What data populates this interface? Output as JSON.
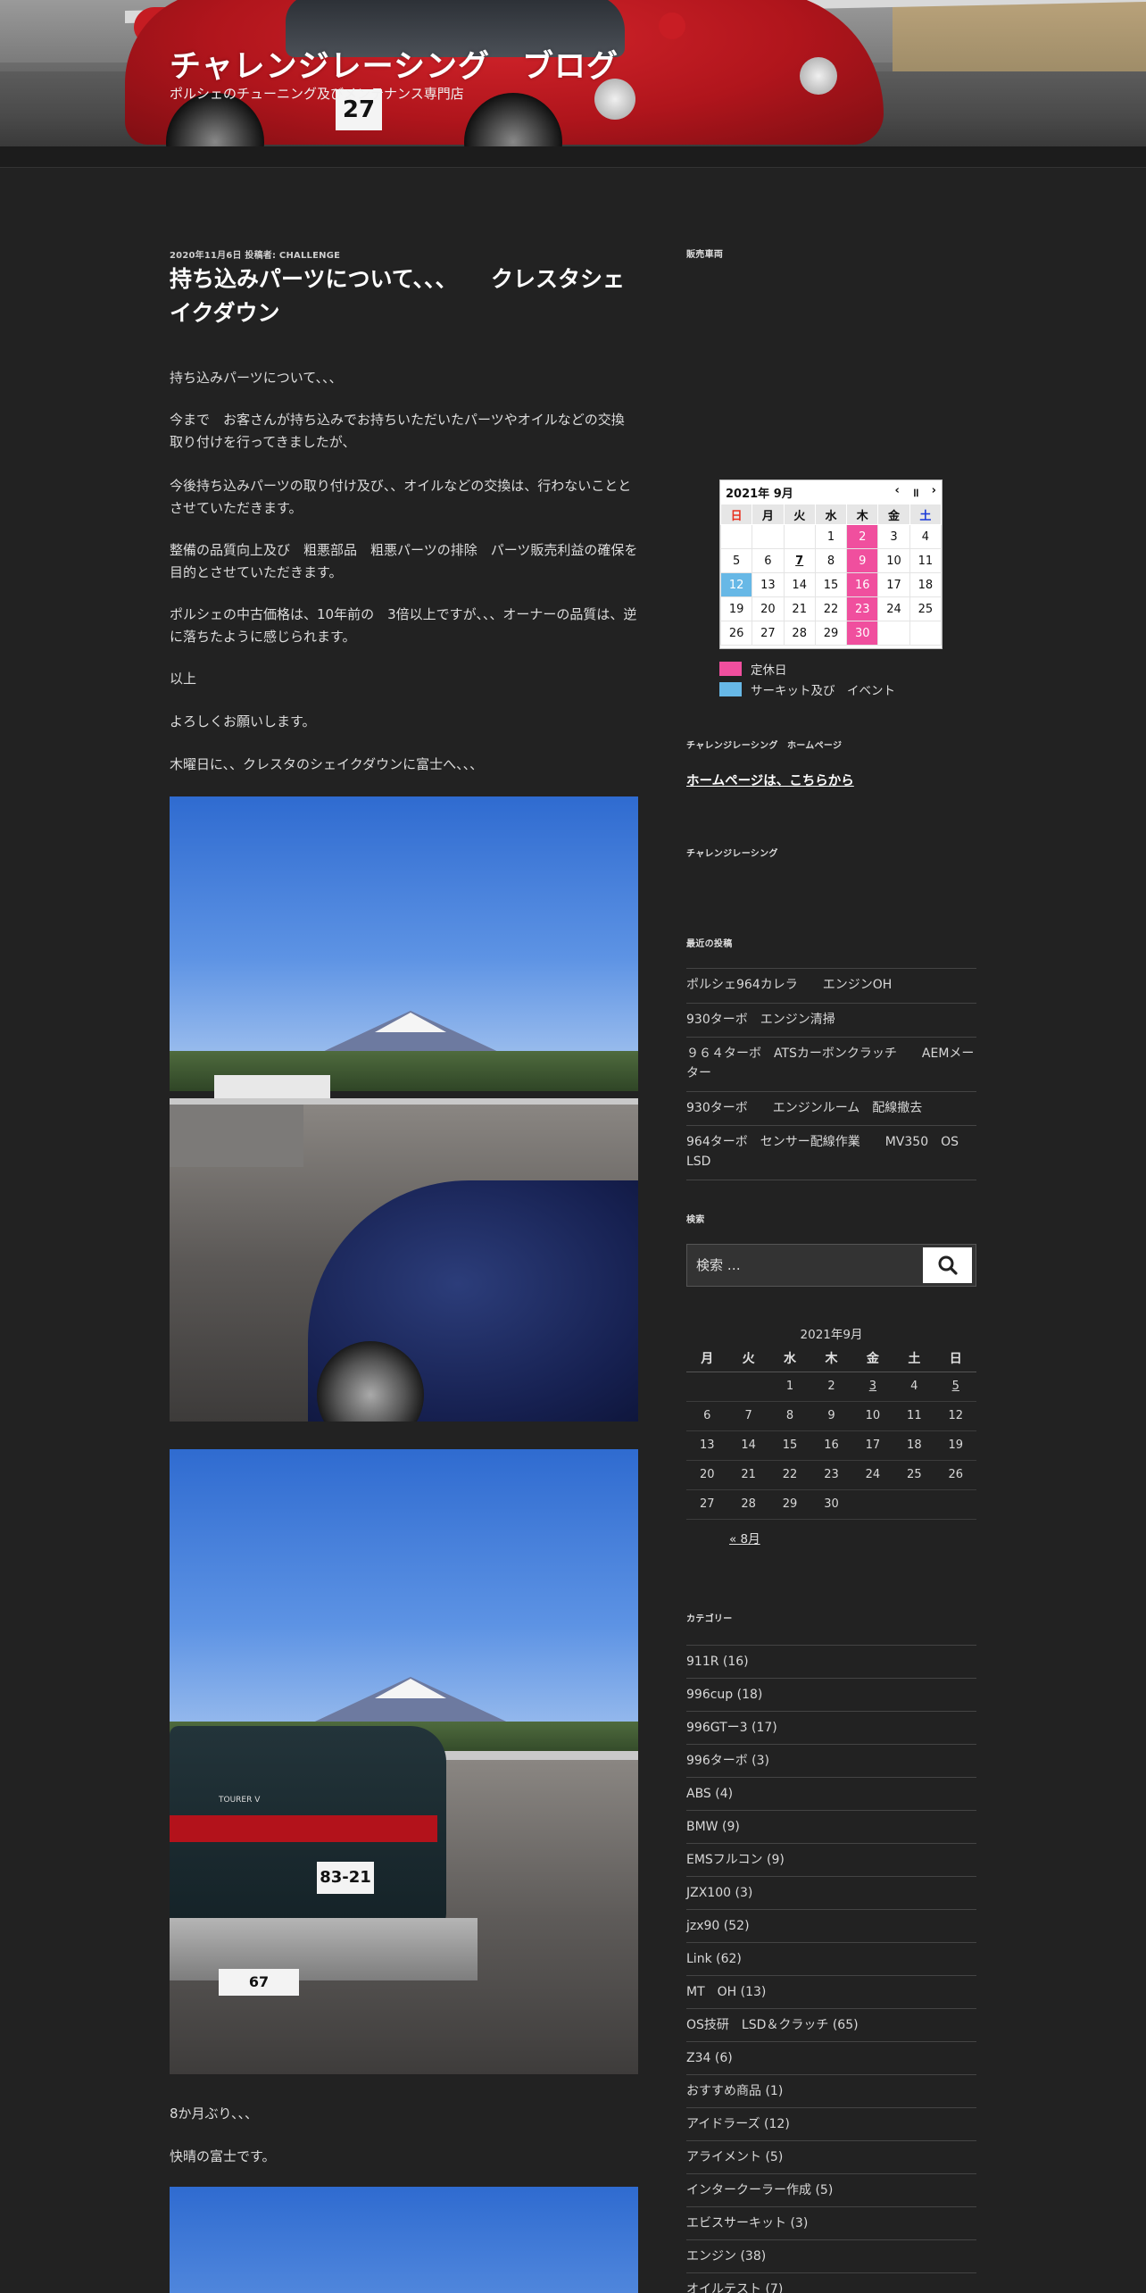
{
  "site": {
    "title": "チャレンジレーシング　ブログ",
    "description": "ポルシェのチューニング及びメンテナンス専門店"
  },
  "header_plate": "27",
  "post": {
    "date": "2020年11月6日",
    "author_prefix": "投稿者:",
    "author": "challenge",
    "title": "持ち込みパーツについて、、、　　クレスタシェイクダウン",
    "paragraphs": [
      "持ち込みパーツについて、、、",
      "今まで　お客さんが持ち込みでお持ちいただいたパーツやオイルなどの交換　取り付けを行ってきましたが、",
      "今後持ち込みパーツの取り付け及び、、オイルなどの交換は、行わないこととさせていただきます。",
      "整備の品質向上及び　粗悪部品　粗悪パーツの排除　パーツ販売利益の確保を目的とさせていただきます。",
      "ポルシェの中古価格は、10年前の　3倍以上ですが、、、オーナーの品質は、逆に落ちたように感じられます。",
      "以上",
      "よろしくお願いします。",
      "木曜日に、、クレスタのシェイクダウンに富士へ、、、"
    ],
    "after_photos": [
      "8か月ぶり、、、",
      "快晴の富士です。"
    ],
    "photo2_plate": "83-21",
    "photo2_plate2": "67",
    "photo2_badge": "TOURER V"
  },
  "sidebar": {
    "sale_title": "販売車両",
    "event_calendar": {
      "month_label": "2021年 9月",
      "nav_prev": "‹",
      "nav_pause": "॥",
      "nav_next": "›",
      "weekdays": [
        "日",
        "月",
        "火",
        "水",
        "木",
        "金",
        "土"
      ],
      "weeks": [
        [
          "",
          "",
          "",
          "1",
          "2",
          "3",
          "4"
        ],
        [
          "5",
          "6",
          "7",
          "8",
          "9",
          "10",
          "11"
        ],
        [
          "12",
          "13",
          "14",
          "15",
          "16",
          "17",
          "18"
        ],
        [
          "19",
          "20",
          "21",
          "22",
          "23",
          "24",
          "25"
        ],
        [
          "26",
          "27",
          "28",
          "29",
          "30",
          "",
          ""
        ]
      ],
      "holiday_days": [
        "2",
        "9",
        "16",
        "23",
        "30"
      ],
      "event_days": [
        "12"
      ],
      "today": "7",
      "legend": [
        {
          "label": "定休日",
          "color": "#f04f9e"
        },
        {
          "label": "サーキット及び　イベント",
          "color": "#67b8e6"
        }
      ]
    },
    "homepage_title": "チャレンジレーシング　ホームページ",
    "homepage_link": "ホームページは、こちらから",
    "racing_title": "チャレンジレーシング",
    "recent_title": "最近の投稿",
    "recent_posts": [
      "ポルシェ964カレラ　　エンジンOH",
      "930ターボ　エンジン清掃",
      "９６４ターボ　ATSカーボンクラッチ　　AEMメーター",
      "930ターボ　　エンジンルーム　配線撤去",
      "964ターボ　センサー配線作業　　MV350　OS　LSD"
    ],
    "search_title": "検索",
    "search_placeholder": "検索 …",
    "archive_calendar": {
      "caption": "2021年9月",
      "weekdays": [
        "月",
        "火",
        "水",
        "木",
        "金",
        "土",
        "日"
      ],
      "weeks": [
        [
          "",
          "",
          "1",
          "2",
          "3",
          "4",
          "5"
        ],
        [
          "6",
          "7",
          "8",
          "9",
          "10",
          "11",
          "12"
        ],
        [
          "13",
          "14",
          "15",
          "16",
          "17",
          "18",
          "19"
        ],
        [
          "20",
          "21",
          "22",
          "23",
          "24",
          "25",
          "26"
        ],
        [
          "27",
          "28",
          "29",
          "30",
          "",
          "",
          ""
        ]
      ],
      "linked_days": [
        "3",
        "5"
      ],
      "prev_link": "« 8月"
    },
    "categories_title": "カテゴリー",
    "categories": [
      "911R (16)",
      "996cup (18)",
      "996GTー3 (17)",
      "996ターボ (3)",
      "ABS (4)",
      "BMW (9)",
      "EMSフルコン (9)",
      "JZX100 (3)",
      "jzx90 (52)",
      "Link (62)",
      "MT　OH (13)",
      "OS技研　LSD＆クラッチ (65)",
      "Z34 (6)",
      "おすすめ商品 (1)",
      "アイドラーズ (12)",
      "アライメント (5)",
      "インタークーラー作成 (5)",
      "エビスサーキット (3)",
      "エンジン (38)",
      "オイルテスト (7)"
    ]
  },
  "colors": {
    "background": "#222222",
    "holiday": "#f04f9e",
    "event": "#67b8e6",
    "header_car": "#c81d24"
  }
}
